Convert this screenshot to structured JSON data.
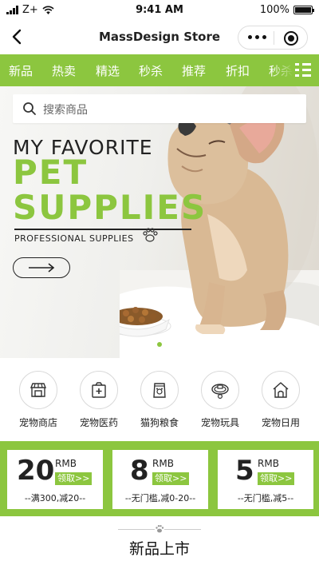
{
  "status": {
    "carrier": "Z+",
    "time": "9:41 AM",
    "battery": "100%",
    "battery_level": 1.0
  },
  "navbar": {
    "title": "MassDesign Store"
  },
  "tabs": [
    "新品",
    "热卖",
    "精选",
    "秒杀",
    "推荐",
    "折扣",
    "秒杀"
  ],
  "search": {
    "placeholder": "搜索商品"
  },
  "banner": {
    "line1": "MY FAVORITE",
    "line2": "PET",
    "line3": "SUPPLIES",
    "subtitle": "PROFESSIONAL SUPPLIES",
    "active_slide": 1
  },
  "categories": [
    {
      "label": "宠物商店",
      "icon": "storefront-icon"
    },
    {
      "label": "宠物医药",
      "icon": "medicine-box-icon"
    },
    {
      "label": "猫狗粮食",
      "icon": "pet-food-bag-icon"
    },
    {
      "label": "宠物玩具",
      "icon": "pet-collar-icon"
    },
    {
      "label": "宠物日用",
      "icon": "pet-house-icon"
    }
  ],
  "coupons": [
    {
      "amount": "20",
      "unit": "RMB",
      "action": "领取>>",
      "rule": "--满300,减20--"
    },
    {
      "amount": "8",
      "unit": "RMB",
      "action": "领取>>",
      "rule": "--无门槛,减0-20--"
    },
    {
      "amount": "5",
      "unit": "RMB",
      "action": "领取>>",
      "rule": "--无门槛,减5--"
    }
  ],
  "section": {
    "title": "新品上市"
  },
  "colors": {
    "accent": "#8cc63f",
    "text": "#222222",
    "background": "#f4f4f4"
  }
}
